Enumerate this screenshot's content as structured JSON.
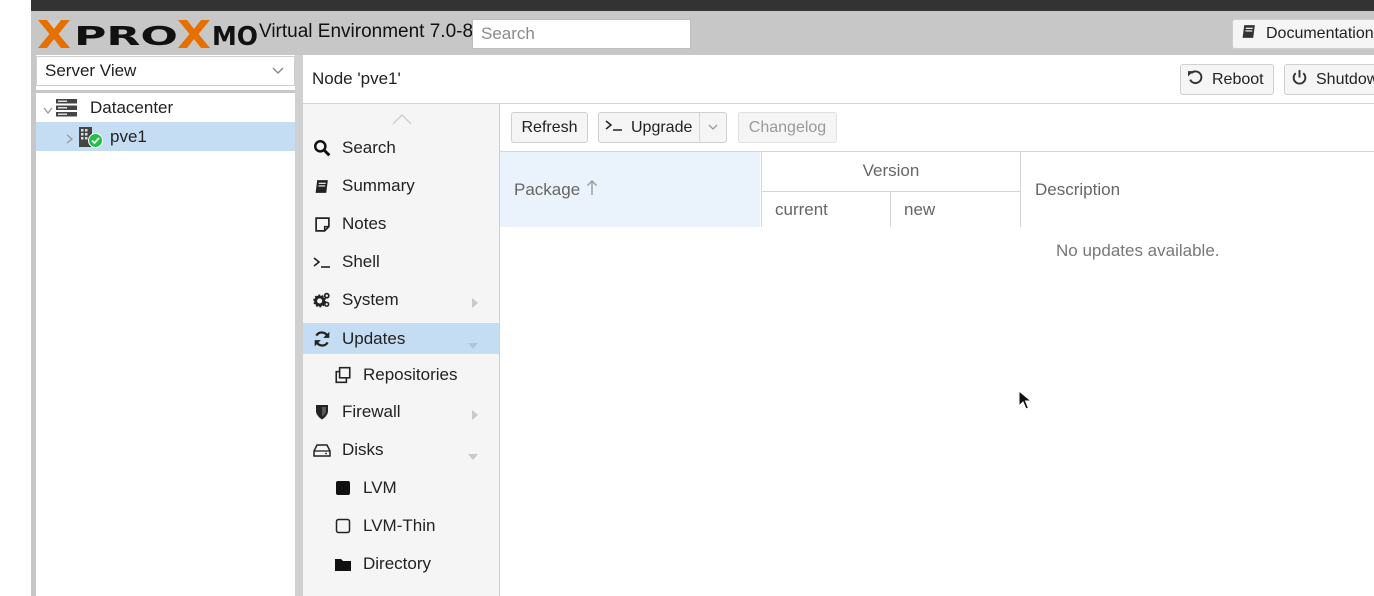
{
  "app": {
    "logo_text": "PROXMOX",
    "version_title": "Virtual Environment 7.0-8",
    "search_placeholder": "Search",
    "documentation_label": "Documentation"
  },
  "tree": {
    "view_selector": "Server View",
    "datacenter_label": "Datacenter",
    "node_label": "pve1",
    "node_status": "online"
  },
  "content": {
    "title": "Node 'pve1'",
    "reboot_label": "Reboot",
    "shutdown_label": "Shutdown"
  },
  "nav": {
    "items": [
      {
        "label": "Search",
        "icon": "search-icon"
      },
      {
        "label": "Summary",
        "icon": "book-icon"
      },
      {
        "label": "Notes",
        "icon": "note-icon"
      },
      {
        "label": "Shell",
        "icon": "terminal-icon"
      },
      {
        "label": "System",
        "icon": "cogs-icon"
      },
      {
        "label": "Updates",
        "icon": "refresh-icon"
      },
      {
        "label": "Repositories",
        "icon": "copy-icon"
      },
      {
        "label": "Firewall",
        "icon": "shield-icon"
      },
      {
        "label": "Disks",
        "icon": "hdd-icon"
      },
      {
        "label": "LVM",
        "icon": "square-icon"
      },
      {
        "label": "LVM-Thin",
        "icon": "square-outline-icon"
      },
      {
        "label": "Directory",
        "icon": "folder-icon"
      }
    ]
  },
  "toolbar": {
    "refresh_label": "Refresh",
    "upgrade_label": "Upgrade",
    "changelog_label": "Changelog"
  },
  "grid": {
    "columns": {
      "package": "Package",
      "version": "Version",
      "current": "current",
      "new": "new",
      "description": "Description"
    },
    "empty_text": "No updates available.",
    "sort_column": "Package",
    "sort_direction": "ascending"
  },
  "colors": {
    "brand_orange": "#e57000",
    "header_gray": "#c7c7c7",
    "selection_blue": "#c5ddf2",
    "status_green": "#21bf4b"
  }
}
